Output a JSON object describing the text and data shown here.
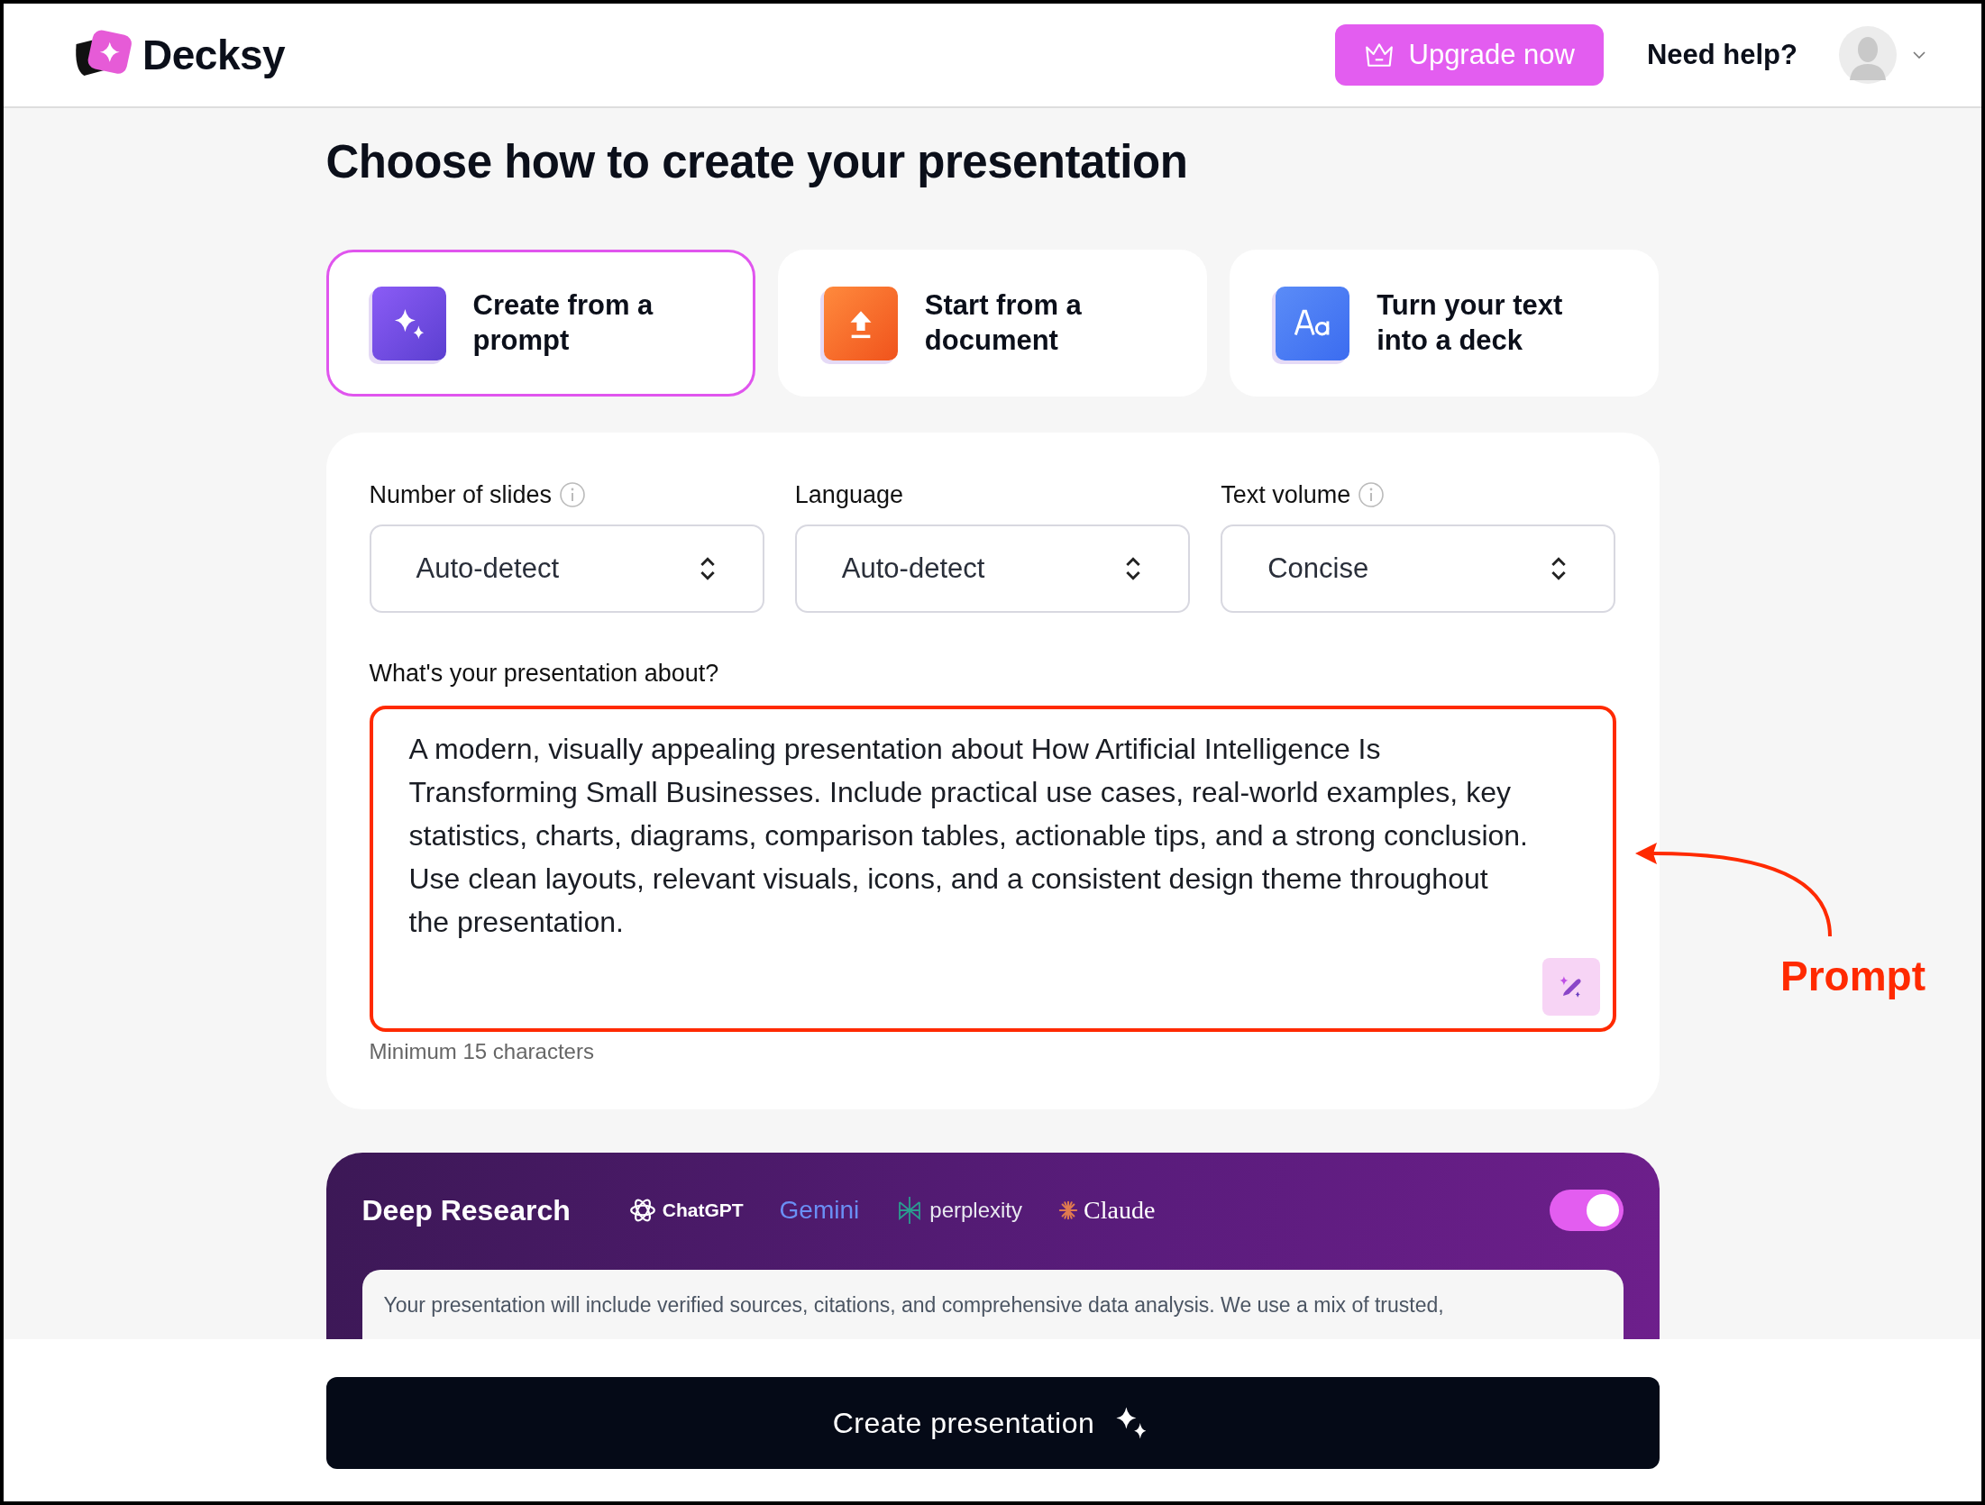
{
  "header": {
    "logo": "Decksy",
    "upgrade_button": "Upgrade now",
    "help_link": "Need help?"
  },
  "title": "Choose how to create your presentation",
  "modes": [
    {
      "label": "Create from a prompt",
      "kind": "prompt",
      "selected": true
    },
    {
      "label": "Start from a document",
      "kind": "document",
      "selected": false
    },
    {
      "label": "Turn your text into a deck",
      "kind": "text",
      "selected": false
    }
  ],
  "settings": [
    {
      "label": "Number of slides",
      "info": true,
      "value": "Auto-detect"
    },
    {
      "label": "Language",
      "info": false,
      "value": "Auto-detect"
    },
    {
      "label": "Text volume",
      "info": true,
      "value": "Concise"
    }
  ],
  "prompt": {
    "label": "What's your presentation about?",
    "value": "A modern, visually appealing presentation about How Artificial Intelligence Is Transforming Small Businesses. Include practical use cases, real-world examples, key statistics, charts, diagrams, comparison tables, actionable tips, and a strong conclusion. Use clean layouts, relevant visuals, icons, and a consistent design theme throughout the presentation.",
    "hint": "Minimum 15 characters"
  },
  "deep_research": {
    "title": "Deep Research",
    "on": true,
    "providers": [
      {
        "name": "ChatGPT",
        "kind": "chatgpt"
      },
      {
        "name": "Gemini",
        "kind": "gemini"
      },
      {
        "name": "perplexity",
        "kind": "perplexity"
      },
      {
        "name": "Claude",
        "kind": "claude"
      }
    ],
    "description": "Your presentation will include verified sources, citations, and comprehensive data analysis. We use a mix of trusted,"
  },
  "create_button": "Create presentation",
  "annotation": {
    "label": "Prompt"
  }
}
